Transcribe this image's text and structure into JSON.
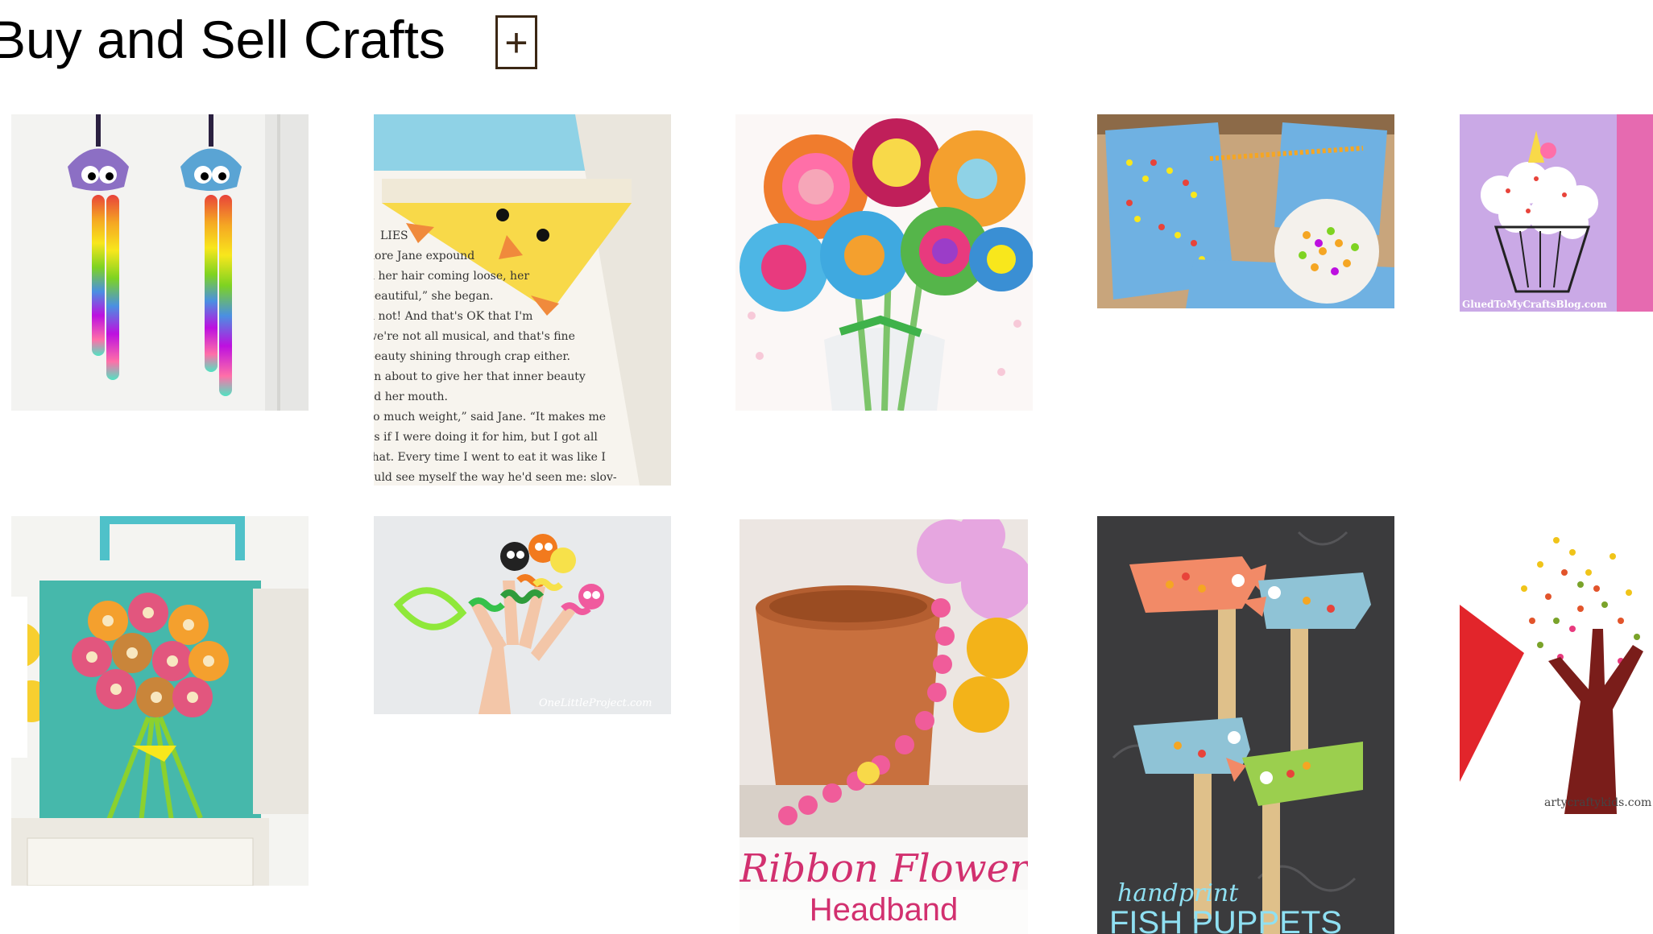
{
  "page": {
    "title": "Buy and Sell Crafts",
    "add_button_label": "+"
  },
  "tiles": [
    {
      "name": "egg-carton-jellyfish",
      "caption": ""
    },
    {
      "name": "chick-corner-bookmark",
      "caption": "",
      "book_text": [
        "LIES",
        "nore Jane expound",
        "h her hair coming loose, her",
        "beautiful,” she began.",
        "n not! And that's OK that I'm",
        "we're not all musical, and that's fine",
        "beauty shining through crap either.",
        "en about to give her that inner beauty",
        "ed her mouth.",
        "so much weight,” said Jane. “It makes me",
        "as if I were doing it for him, but I got all",
        "that. Every time I went to eat it was like I",
        "ould see myself the way he'd seen me: slov-"
      ]
    },
    {
      "name": "felt-flower-bouquet",
      "caption": ""
    },
    {
      "name": "cereal-counting-activity",
      "caption": ""
    },
    {
      "name": "unicorn-cupcake-craft",
      "caption": "GluedToMyCraftsBlog.com"
    },
    {
      "name": "egg-carton-flower-canvas",
      "caption": ""
    },
    {
      "name": "pipe-cleaner-finger-puppets",
      "caption": "OneLittleProject.com"
    },
    {
      "name": "ribbon-flower-headband",
      "caption": "",
      "title_line1": "Ribbon Flower",
      "title_line2": "Headband"
    },
    {
      "name": "handprint-fish-puppets",
      "caption": "",
      "title_line1": "handprint",
      "title_line2": "FISH PUPPETS"
    },
    {
      "name": "fingerprint-tree-art",
      "caption": "artycraftykids.com"
    }
  ]
}
